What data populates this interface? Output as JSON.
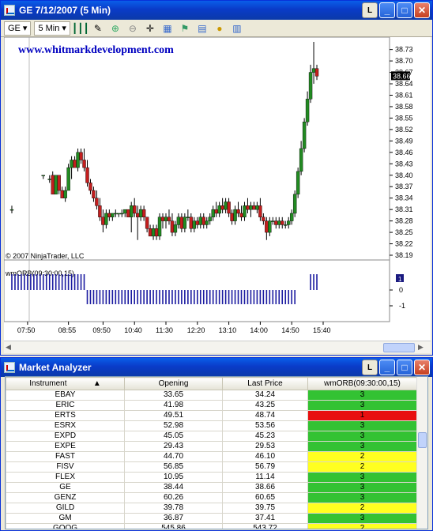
{
  "chart_window": {
    "title": "GE  7/12/2007  (5 Min)",
    "lock_label": "L",
    "toolbar": {
      "symbol": "GE",
      "interval": "5 Min"
    }
  },
  "chart": {
    "watermark": "www.whitmarkdevelopment.com",
    "copyright": "© 2007 NinjaTrader, LLC",
    "indicator_label": "wmORB(09:30:00,15)",
    "panel_marker": "1",
    "last_price_tag": "38.66",
    "price_ticks": [
      "38.73",
      "38.70",
      "38.67",
      "38.64",
      "38.61",
      "38.58",
      "38.55",
      "38.52",
      "38.49",
      "38.46",
      "38.43",
      "38.40",
      "38.37",
      "38.34",
      "38.31",
      "38.28",
      "38.25",
      "38.22",
      "38.19"
    ],
    "ind_ticks": [
      "0",
      "-1"
    ],
    "time_ticks": [
      "07:50",
      "08:55",
      "09:50",
      "10:40",
      "11:30",
      "12:20",
      "13:10",
      "14:00",
      "14:50",
      "15:40"
    ],
    "colors": {
      "up": "#228b22",
      "down": "#c41e1e",
      "wick": "#000000",
      "indicator": "#1a1aa0",
      "watermark": "#0000c0"
    }
  },
  "chart_data": {
    "type": "candlestick",
    "x_label": "",
    "y_label": "",
    "y_range": [
      38.19,
      38.75
    ],
    "candles": [
      {
        "time": "07:30",
        "open": 38.31,
        "high": 38.32,
        "low": 38.3,
        "close": 38.31
      },
      {
        "time": "08:20",
        "open": 38.4,
        "high": 38.4,
        "low": 38.39,
        "close": 38.4
      },
      {
        "time": "08:30",
        "open": 38.39,
        "high": 38.4,
        "low": 38.38,
        "close": 38.39
      },
      {
        "time": "08:35",
        "open": 38.4,
        "high": 38.41,
        "low": 38.35,
        "close": 38.35
      },
      {
        "time": "08:40",
        "open": 38.35,
        "high": 38.4,
        "low": 38.35,
        "close": 38.4
      },
      {
        "time": "08:45",
        "open": 38.4,
        "high": 38.4,
        "low": 38.35,
        "close": 38.36
      },
      {
        "time": "08:50",
        "open": 38.36,
        "high": 38.37,
        "low": 38.34,
        "close": 38.34
      },
      {
        "time": "08:55",
        "open": 38.34,
        "high": 38.37,
        "low": 38.33,
        "close": 38.36
      },
      {
        "time": "09:00",
        "open": 38.36,
        "high": 38.43,
        "low": 38.36,
        "close": 38.42
      },
      {
        "time": "09:05",
        "open": 38.42,
        "high": 38.45,
        "low": 38.39,
        "close": 38.44
      },
      {
        "time": "09:10",
        "open": 38.44,
        "high": 38.45,
        "low": 38.42,
        "close": 38.42
      },
      {
        "time": "09:15",
        "open": 38.42,
        "high": 38.47,
        "low": 38.41,
        "close": 38.46
      },
      {
        "time": "09:20",
        "open": 38.46,
        "high": 38.47,
        "low": 38.43,
        "close": 38.44
      },
      {
        "time": "09:25",
        "open": 38.44,
        "high": 38.47,
        "low": 38.41,
        "close": 38.42
      },
      {
        "time": "09:30",
        "open": 38.42,
        "high": 38.44,
        "low": 38.37,
        "close": 38.38
      },
      {
        "time": "09:35",
        "open": 38.38,
        "high": 38.39,
        "low": 38.35,
        "close": 38.36
      },
      {
        "time": "09:40",
        "open": 38.36,
        "high": 38.37,
        "low": 38.33,
        "close": 38.34
      },
      {
        "time": "09:45",
        "open": 38.34,
        "high": 38.36,
        "low": 38.31,
        "close": 38.32
      },
      {
        "time": "09:50",
        "open": 38.32,
        "high": 38.34,
        "low": 38.28,
        "close": 38.29
      },
      {
        "time": "09:55",
        "open": 38.29,
        "high": 38.31,
        "low": 38.25,
        "close": 38.27
      },
      {
        "time": "10:00",
        "open": 38.27,
        "high": 38.31,
        "low": 38.26,
        "close": 38.3
      },
      {
        "time": "10:05",
        "open": 38.3,
        "high": 38.31,
        "low": 38.28,
        "close": 38.29
      },
      {
        "time": "10:10",
        "open": 38.29,
        "high": 38.3,
        "low": 38.28,
        "close": 38.3
      },
      {
        "time": "10:15",
        "open": 38.3,
        "high": 38.31,
        "low": 38.29,
        "close": 38.3
      },
      {
        "time": "10:20",
        "open": 38.3,
        "high": 38.3,
        "low": 38.29,
        "close": 38.3
      },
      {
        "time": "10:25",
        "open": 38.3,
        "high": 38.31,
        "low": 38.29,
        "close": 38.3
      },
      {
        "time": "10:30",
        "open": 38.3,
        "high": 38.31,
        "low": 38.29,
        "close": 38.31
      },
      {
        "time": "10:35",
        "open": 38.31,
        "high": 38.31,
        "low": 38.29,
        "close": 38.29
      },
      {
        "time": "10:40",
        "open": 38.29,
        "high": 38.33,
        "low": 38.25,
        "close": 38.32
      },
      {
        "time": "10:45",
        "open": 38.32,
        "high": 38.34,
        "low": 38.29,
        "close": 38.3
      },
      {
        "time": "10:50",
        "open": 38.3,
        "high": 38.32,
        "low": 38.23,
        "close": 38.29
      },
      {
        "time": "10:55",
        "open": 38.29,
        "high": 38.32,
        "low": 38.28,
        "close": 38.31
      },
      {
        "time": "11:00",
        "open": 38.31,
        "high": 38.32,
        "low": 38.28,
        "close": 38.29
      },
      {
        "time": "11:05",
        "open": 38.29,
        "high": 38.29,
        "low": 38.25,
        "close": 38.26
      },
      {
        "time": "11:10",
        "open": 38.26,
        "high": 38.27,
        "low": 38.24,
        "close": 38.24
      },
      {
        "time": "11:15",
        "open": 38.24,
        "high": 38.27,
        "low": 38.23,
        "close": 38.26
      },
      {
        "time": "11:20",
        "open": 38.26,
        "high": 38.27,
        "low": 38.23,
        "close": 38.24
      },
      {
        "time": "11:25",
        "open": 38.24,
        "high": 38.3,
        "low": 38.23,
        "close": 38.29
      },
      {
        "time": "11:30",
        "open": 38.29,
        "high": 38.3,
        "low": 38.26,
        "close": 38.28
      },
      {
        "time": "11:35",
        "open": 38.28,
        "high": 38.3,
        "low": 38.26,
        "close": 38.29
      },
      {
        "time": "11:40",
        "open": 38.29,
        "high": 38.31,
        "low": 38.27,
        "close": 38.28
      },
      {
        "time": "11:45",
        "open": 38.28,
        "high": 38.3,
        "low": 38.24,
        "close": 38.25
      },
      {
        "time": "11:50",
        "open": 38.25,
        "high": 38.28,
        "low": 38.24,
        "close": 38.27
      },
      {
        "time": "11:55",
        "open": 38.27,
        "high": 38.3,
        "low": 38.26,
        "close": 38.29
      },
      {
        "time": "12:00",
        "open": 38.29,
        "high": 38.3,
        "low": 38.25,
        "close": 38.26
      },
      {
        "time": "12:05",
        "open": 38.26,
        "high": 38.3,
        "low": 38.25,
        "close": 38.29
      },
      {
        "time": "12:10",
        "open": 38.29,
        "high": 38.31,
        "low": 38.28,
        "close": 38.29
      },
      {
        "time": "12:15",
        "open": 38.29,
        "high": 38.3,
        "low": 38.25,
        "close": 38.26
      },
      {
        "time": "12:20",
        "open": 38.26,
        "high": 38.29,
        "low": 38.25,
        "close": 38.28
      },
      {
        "time": "12:25",
        "open": 38.28,
        "high": 38.29,
        "low": 38.26,
        "close": 38.27
      },
      {
        "time": "12:30",
        "open": 38.27,
        "high": 38.3,
        "low": 38.26,
        "close": 38.29
      },
      {
        "time": "12:35",
        "open": 38.29,
        "high": 38.3,
        "low": 38.26,
        "close": 38.27
      },
      {
        "time": "12:40",
        "open": 38.27,
        "high": 38.29,
        "low": 38.26,
        "close": 38.28
      },
      {
        "time": "12:45",
        "open": 38.28,
        "high": 38.3,
        "low": 38.27,
        "close": 38.29
      },
      {
        "time": "12:50",
        "open": 38.29,
        "high": 38.32,
        "low": 38.28,
        "close": 38.31
      },
      {
        "time": "12:55",
        "open": 38.31,
        "high": 38.33,
        "low": 38.29,
        "close": 38.3
      },
      {
        "time": "13:00",
        "open": 38.3,
        "high": 38.33,
        "low": 38.29,
        "close": 38.32
      },
      {
        "time": "13:05",
        "open": 38.32,
        "high": 38.34,
        "low": 38.3,
        "close": 38.31
      },
      {
        "time": "13:10",
        "open": 38.31,
        "high": 38.34,
        "low": 38.3,
        "close": 38.33
      },
      {
        "time": "13:15",
        "open": 38.33,
        "high": 38.34,
        "low": 38.29,
        "close": 38.3
      },
      {
        "time": "13:20",
        "open": 38.3,
        "high": 38.31,
        "low": 38.27,
        "close": 38.28
      },
      {
        "time": "13:25",
        "open": 38.28,
        "high": 38.32,
        "low": 38.27,
        "close": 38.31
      },
      {
        "time": "13:30",
        "open": 38.31,
        "high": 38.33,
        "low": 38.29,
        "close": 38.3
      },
      {
        "time": "13:35",
        "open": 38.3,
        "high": 38.32,
        "low": 38.28,
        "close": 38.29
      },
      {
        "time": "13:40",
        "open": 38.29,
        "high": 38.33,
        "low": 38.28,
        "close": 38.32
      },
      {
        "time": "13:45",
        "open": 38.32,
        "high": 38.34,
        "low": 38.3,
        "close": 38.31
      },
      {
        "time": "13:50",
        "open": 38.31,
        "high": 38.33,
        "low": 38.29,
        "close": 38.32
      },
      {
        "time": "13:55",
        "open": 38.32,
        "high": 38.33,
        "low": 38.31,
        "close": 38.31
      },
      {
        "time": "14:00",
        "open": 38.31,
        "high": 38.33,
        "low": 38.3,
        "close": 38.32
      },
      {
        "time": "14:05",
        "open": 38.32,
        "high": 38.34,
        "low": 38.28,
        "close": 38.29
      },
      {
        "time": "14:10",
        "open": 38.29,
        "high": 38.3,
        "low": 38.27,
        "close": 38.28
      },
      {
        "time": "14:15",
        "open": 38.28,
        "high": 38.29,
        "low": 38.23,
        "close": 38.25
      },
      {
        "time": "14:20",
        "open": 38.25,
        "high": 38.29,
        "low": 38.24,
        "close": 38.28
      },
      {
        "time": "14:25",
        "open": 38.28,
        "high": 38.29,
        "low": 38.27,
        "close": 38.28
      },
      {
        "time": "14:30",
        "open": 38.28,
        "high": 38.29,
        "low": 38.26,
        "close": 38.27
      },
      {
        "time": "14:35",
        "open": 38.27,
        "high": 38.29,
        "low": 38.26,
        "close": 38.28
      },
      {
        "time": "14:40",
        "open": 38.28,
        "high": 38.29,
        "low": 38.26,
        "close": 38.27
      },
      {
        "time": "14:45",
        "open": 38.27,
        "high": 38.28,
        "low": 38.26,
        "close": 38.27
      },
      {
        "time": "14:50",
        "open": 38.27,
        "high": 38.29,
        "low": 38.26,
        "close": 38.28
      },
      {
        "time": "14:55",
        "open": 38.28,
        "high": 38.31,
        "low": 38.27,
        "close": 38.3
      },
      {
        "time": "15:00",
        "open": 38.3,
        "high": 38.36,
        "low": 38.29,
        "close": 38.35
      },
      {
        "time": "15:05",
        "open": 38.35,
        "high": 38.42,
        "low": 38.34,
        "close": 38.41
      },
      {
        "time": "15:10",
        "open": 38.41,
        "high": 38.49,
        "low": 38.4,
        "close": 38.47
      },
      {
        "time": "15:15",
        "open": 38.47,
        "high": 38.55,
        "low": 38.46,
        "close": 38.54
      },
      {
        "time": "15:20",
        "open": 38.54,
        "high": 38.62,
        "low": 38.53,
        "close": 38.6
      },
      {
        "time": "15:25",
        "open": 38.6,
        "high": 38.69,
        "low": 38.59,
        "close": 38.67
      },
      {
        "time": "15:30",
        "open": 38.67,
        "high": 38.75,
        "low": 38.64,
        "close": 38.68
      },
      {
        "time": "15:35",
        "open": 38.68,
        "high": 38.69,
        "low": 38.65,
        "close": 38.66
      }
    ],
    "indicator_series": [
      {
        "name": "wmORB(09:30:00,15)",
        "time_range": [
          "07:30",
          "09:25"
        ],
        "value": 1
      },
      {
        "name": "wmORB(09:30:00,15)",
        "time_range": [
          "09:30",
          "15:00"
        ],
        "value": -1
      },
      {
        "name": "wmORB(09:30:00,15)",
        "time_range": [
          "15:25",
          "15:35"
        ],
        "value": 1
      }
    ]
  },
  "analyzer_window": {
    "title": "Market Analyzer",
    "lock_label": "L",
    "columns": [
      "Instrument",
      "Opening",
      "Last Price",
      "wmORB(09:30:00,15)"
    ],
    "sort_indicator": "▲",
    "rows": [
      {
        "instrument": "EBAY",
        "opening": "33.65",
        "last": "34.24",
        "orb": "3",
        "color": "green"
      },
      {
        "instrument": "ERIC",
        "opening": "41.98",
        "last": "43.25",
        "orb": "3",
        "color": "green"
      },
      {
        "instrument": "ERTS",
        "opening": "49.51",
        "last": "48.74",
        "orb": "1",
        "color": "red"
      },
      {
        "instrument": "ESRX",
        "opening": "52.98",
        "last": "53.56",
        "orb": "3",
        "color": "green"
      },
      {
        "instrument": "EXPD",
        "opening": "45.05",
        "last": "45.23",
        "orb": "3",
        "color": "green"
      },
      {
        "instrument": "EXPE",
        "opening": "29.43",
        "last": "29.53",
        "orb": "3",
        "color": "green"
      },
      {
        "instrument": "FAST",
        "opening": "44.70",
        "last": "46.10",
        "orb": "2",
        "color": "yellow"
      },
      {
        "instrument": "FISV",
        "opening": "56.85",
        "last": "56.79",
        "orb": "2",
        "color": "yellow"
      },
      {
        "instrument": "FLEX",
        "opening": "10.95",
        "last": "11.14",
        "orb": "3",
        "color": "green"
      },
      {
        "instrument": "GE",
        "opening": "38.44",
        "last": "38.66",
        "orb": "3",
        "color": "green"
      },
      {
        "instrument": "GENZ",
        "opening": "60.26",
        "last": "60.65",
        "orb": "3",
        "color": "green"
      },
      {
        "instrument": "GILD",
        "opening": "39.78",
        "last": "39.75",
        "orb": "2",
        "color": "yellow"
      },
      {
        "instrument": "GM",
        "opening": "36.87",
        "last": "37.41",
        "orb": "3",
        "color": "green"
      },
      {
        "instrument": "GOOG",
        "opening": "545.86",
        "last": "543.72",
        "orb": "2",
        "color": "yellow"
      }
    ]
  }
}
